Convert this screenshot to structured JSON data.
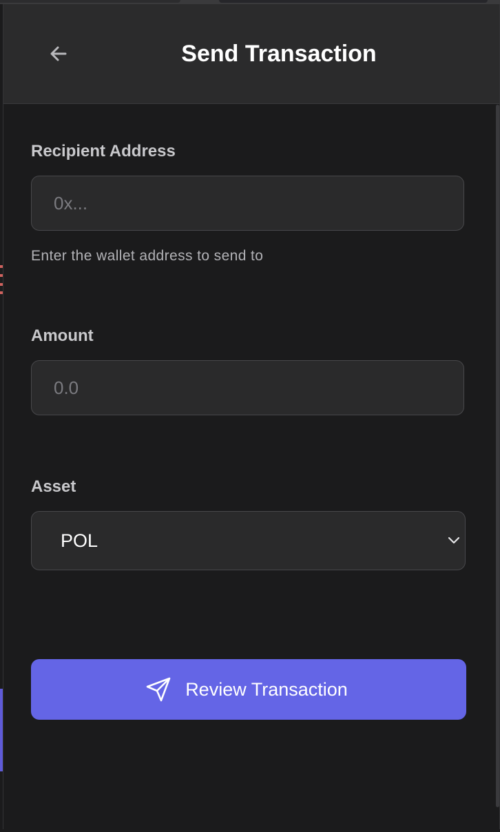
{
  "header": {
    "back_icon": "arrow-left-icon",
    "title": "Send Transaction"
  },
  "form": {
    "recipient": {
      "label": "Recipient Address",
      "placeholder": "0x...",
      "value": "",
      "helper": "Enter the wallet address to send to"
    },
    "amount": {
      "label": "Amount",
      "placeholder": "0.0",
      "value": ""
    },
    "asset": {
      "label": "Asset",
      "selected": "POL",
      "icon": "chevron-down-icon"
    },
    "submit": {
      "label": "Review Transaction",
      "icon": "send-icon"
    }
  },
  "colors": {
    "background": "#1b1b1c",
    "header": "#2b2b2c",
    "field": "#2a2a2b",
    "accent": "#6465e6"
  }
}
